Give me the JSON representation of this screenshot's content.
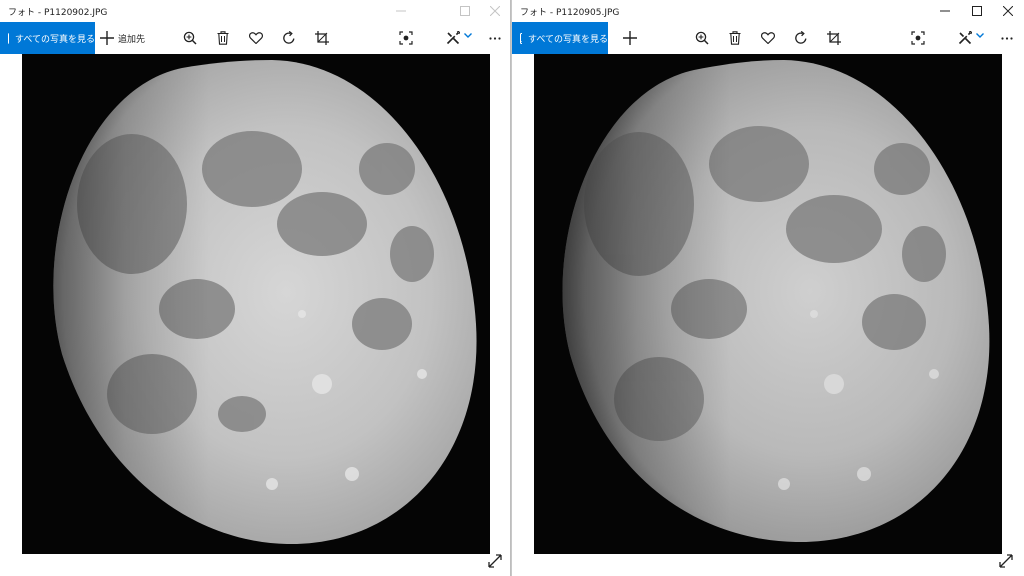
{
  "windows": [
    {
      "title": "フォト - P1120902.JPG",
      "all_photos_label": "すべての写真を見る",
      "add_to_label": "追加先"
    },
    {
      "title": "フォト - P1120905.JPG",
      "all_photos_label": "すべての写真を見る"
    }
  ],
  "colors": {
    "accent": "#0078d7",
    "chevron": "#0078d7",
    "photo_background": "#050505"
  },
  "icons": [
    "photos-app-icon",
    "add-icon",
    "zoom-in-icon",
    "delete-icon",
    "favorite-icon",
    "rotate-icon",
    "crop-icon",
    "edit-icon",
    "chevron-down-icon",
    "more-icon",
    "minimize-icon",
    "maximize-icon",
    "close-icon",
    "expand-icon"
  ]
}
